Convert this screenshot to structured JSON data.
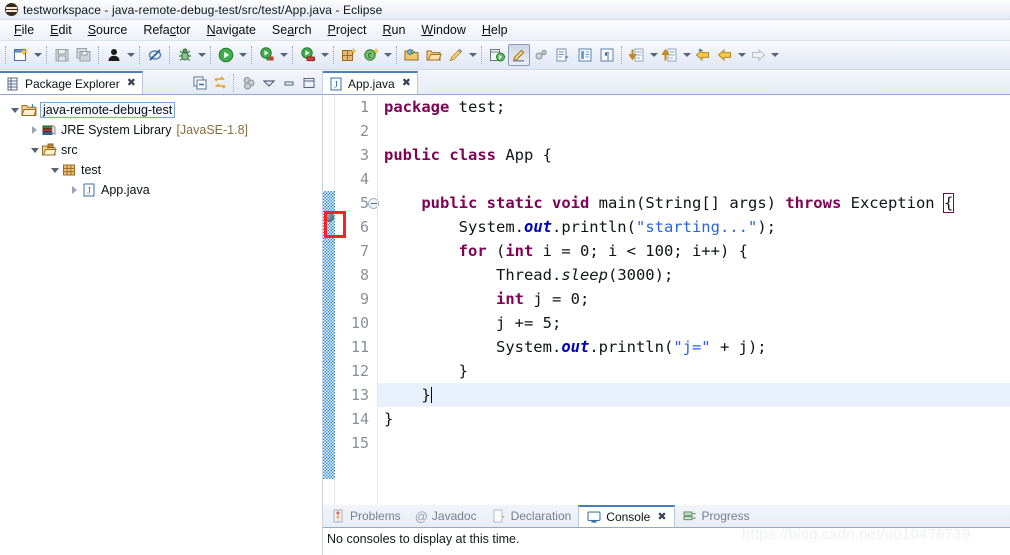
{
  "window": {
    "title": "testworkspace - java-remote-debug-test/src/test/App.java - Eclipse",
    "logo_icon": "eclipse-logo-icon"
  },
  "menubar": {
    "items": [
      {
        "label": "File",
        "mnemonic": "F"
      },
      {
        "label": "Edit",
        "mnemonic": "E"
      },
      {
        "label": "Source",
        "mnemonic": "S"
      },
      {
        "label": "Refactor",
        "mnemonic": "c"
      },
      {
        "label": "Navigate",
        "mnemonic": "N"
      },
      {
        "label": "Search",
        "mnemonic": "a"
      },
      {
        "label": "Project",
        "mnemonic": "P"
      },
      {
        "label": "Run",
        "mnemonic": "R"
      },
      {
        "label": "Window",
        "mnemonic": "W"
      },
      {
        "label": "Help",
        "mnemonic": "H"
      }
    ]
  },
  "toolbar": {
    "buttons": [
      {
        "name": "new-wizard-icon",
        "label": "New"
      },
      {
        "name": "save-icon",
        "label": "Save"
      },
      {
        "name": "save-all-icon",
        "label": "Save All"
      },
      {
        "name": "person-icon",
        "label": "Toggle Mark Occurrences"
      },
      {
        "name": "skip-breakpoints-icon",
        "label": "Skip All Breakpoints"
      },
      {
        "name": "debug-icon",
        "label": "Debug"
      },
      {
        "name": "run-icon",
        "label": "Run"
      },
      {
        "name": "run-external-tools-icon",
        "label": "External Tools"
      },
      {
        "name": "run-coverage-icon",
        "label": "Coverage"
      },
      {
        "name": "new-package-icon",
        "label": "New Java Package"
      },
      {
        "name": "new-class-icon",
        "label": "New Java Class"
      },
      {
        "name": "open-type-icon",
        "label": "Open Type"
      },
      {
        "name": "open-resource-icon",
        "label": "Open Task"
      },
      {
        "name": "search-pencil-icon",
        "label": "Search"
      },
      {
        "name": "java-perspective-icon",
        "label": "Java Perspective"
      },
      {
        "name": "edit-highlight-icon",
        "label": "Toggle Block Selection"
      },
      {
        "name": "link-icon",
        "label": "Link"
      },
      {
        "name": "next-annotation-icon",
        "label": "Next Annotation"
      },
      {
        "name": "toggle-view-icon",
        "label": "Toggle View"
      },
      {
        "name": "paragraph-icon",
        "label": "Show Whitespace"
      },
      {
        "name": "next-edit-icon",
        "label": "Next Edit Location"
      },
      {
        "name": "previous-edit-icon",
        "label": "Previous Edit Location"
      },
      {
        "name": "back-star-icon",
        "label": "Back to"
      },
      {
        "name": "back-icon",
        "label": "Back"
      },
      {
        "name": "forward-icon",
        "label": "Forward"
      }
    ]
  },
  "package_explorer": {
    "tab_label": "Package Explorer",
    "tab_icon": "package-explorer-icon",
    "close_icon": "close-icon",
    "tools": [
      {
        "name": "collapse-all-icon",
        "label": "Collapse All"
      },
      {
        "name": "link-with-editor-icon",
        "label": "Link with Editor"
      },
      {
        "name": "filters-icon",
        "label": "Filters"
      },
      {
        "name": "view-menu-icon",
        "label": "View Menu"
      },
      {
        "name": "minimize-icon",
        "label": "Minimize"
      },
      {
        "name": "maximize-icon",
        "label": "Maximize"
      }
    ],
    "tree": [
      {
        "label": "java-remote-debug-test",
        "icon": "project-icon",
        "indent": 0,
        "twisty": "down",
        "selected": true,
        "suffix": ""
      },
      {
        "label": "JRE System Library",
        "icon": "jre-library-icon",
        "indent": 1,
        "twisty": "right",
        "selected": false,
        "suffix": "[JavaSE-1.8]"
      },
      {
        "label": "src",
        "icon": "source-folder-icon",
        "indent": 1,
        "twisty": "down",
        "selected": false,
        "suffix": ""
      },
      {
        "label": "test",
        "icon": "package-icon",
        "indent": 2,
        "twisty": "down",
        "selected": false,
        "suffix": ""
      },
      {
        "label": "App.java",
        "icon": "java-file-icon",
        "indent": 3,
        "twisty": "right",
        "selected": false,
        "suffix": ""
      }
    ]
  },
  "editor": {
    "tab_label": "App.java",
    "tab_icon": "java-file-icon",
    "close_icon": "close-icon",
    "current_line": 13,
    "breakpoint_line": 6,
    "fold_line": 5,
    "lines": [
      {
        "n": 1,
        "html": "<span class=\"kw\">package</span> test;"
      },
      {
        "n": 2,
        "html": ""
      },
      {
        "n": 3,
        "html": "<span class=\"kw\">public</span> <span class=\"kw\">class</span> App {"
      },
      {
        "n": 4,
        "html": ""
      },
      {
        "n": 5,
        "html": "    <span class=\"kw\">public</span> <span class=\"kw\">static</span> <span class=\"kw\">void</span> main(String[] args) <span class=\"kw\">throws</span> Exception <span class=\"brk-box\">{</span>"
      },
      {
        "n": 6,
        "html": "        System.<span class=\"fld\">out</span>.println(<span class=\"str\">\"starting...\"</span>);"
      },
      {
        "n": 7,
        "html": "        <span class=\"kw\">for</span> (<span class=\"kw\">int</span> i = 0; i &lt; 100; i++) {"
      },
      {
        "n": 8,
        "html": "            Thread.<span class=\"mth\">sleep</span>(3000);"
      },
      {
        "n": 9,
        "html": "            <span class=\"kw\">int</span> j = 0;"
      },
      {
        "n": 10,
        "html": "            j += 5;"
      },
      {
        "n": 11,
        "html": "            System.<span class=\"fld\">out</span>.println(<span class=\"str\">\"j=\"</span> + j);"
      },
      {
        "n": 12,
        "html": "        }"
      },
      {
        "n": 13,
        "html": "    }<span class=\"caret\"></span>"
      },
      {
        "n": 14,
        "html": "}"
      },
      {
        "n": 15,
        "html": ""
      }
    ],
    "source_text": "package test;\n\npublic class App {\n\n    public static void main(String[] args) throws Exception {\n        System.out.println(\"starting...\");\n        for (int i = 0; i < 100; i++) {\n            Thread.sleep(3000);\n            int j = 0;\n            j += 5;\n            System.out.println(\"j=\" + j);\n        }\n    }\n}\n"
  },
  "bottom_panel": {
    "tabs": [
      {
        "label": "Problems",
        "icon": "problems-icon",
        "active": false
      },
      {
        "label": "Javadoc",
        "icon": "javadoc-icon",
        "active": false
      },
      {
        "label": "Declaration",
        "icon": "declaration-icon",
        "active": false
      },
      {
        "label": "Console",
        "icon": "console-icon",
        "active": true,
        "close_icon": "close-icon"
      },
      {
        "label": "Progress",
        "icon": "progress-icon",
        "active": false
      }
    ],
    "console_message": "No consoles to display at this time."
  },
  "watermark": "https://blog.csdn.net/u010476739",
  "colors": {
    "keyword": "#7f0055",
    "string": "#2a65d8",
    "field": "#0000c0",
    "tab_accent": "#4a7ebb",
    "annotation_red": "#fb2222",
    "current_line": "#e8f1fb"
  }
}
